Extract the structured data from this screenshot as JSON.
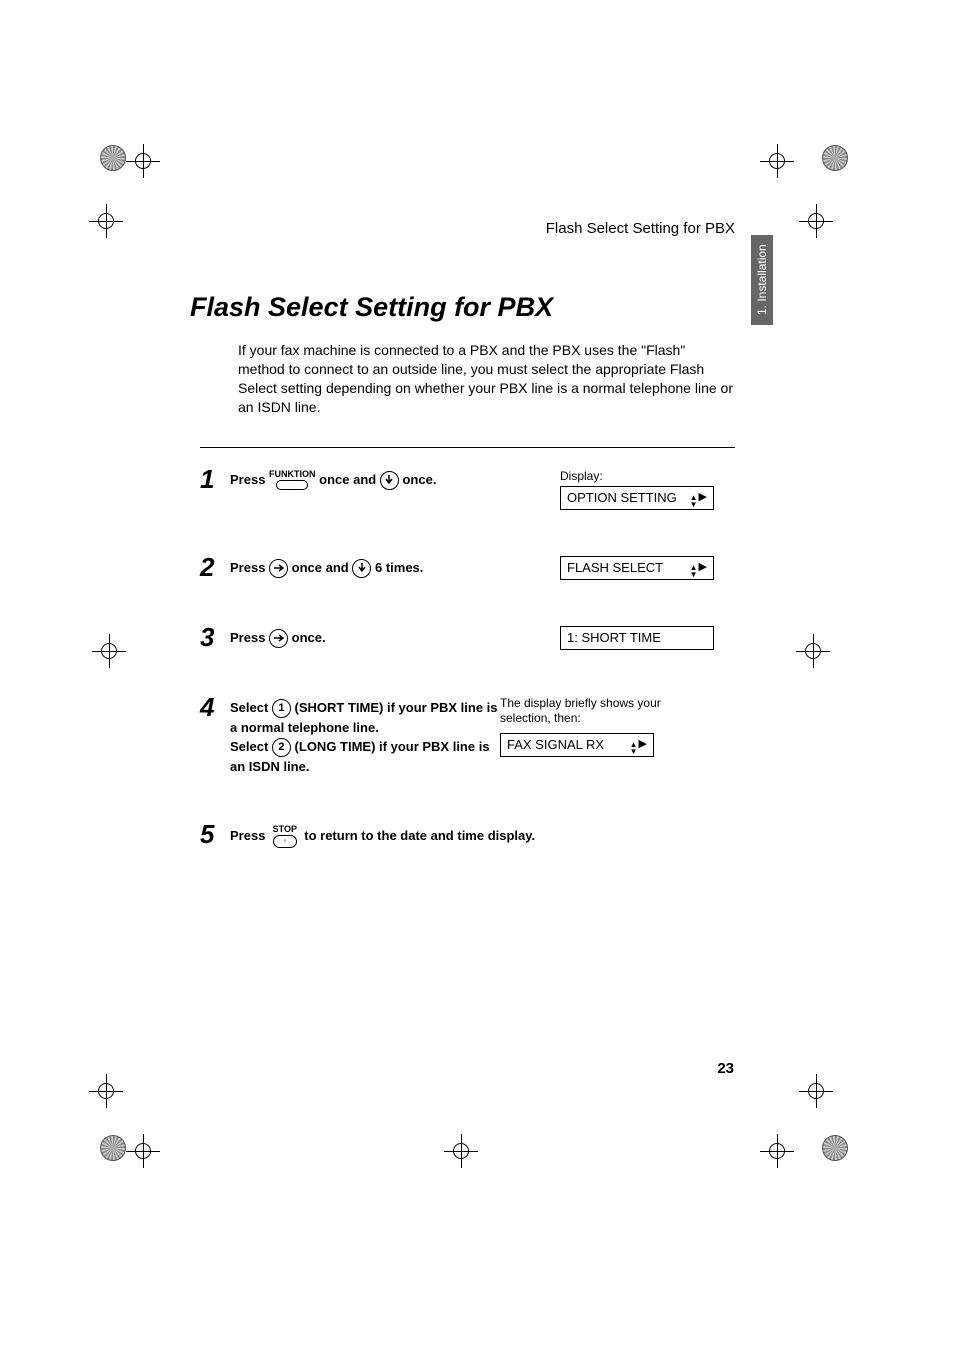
{
  "header": {
    "running_title": "Flash Select Setting for PBX",
    "side_tab": "1. Installation"
  },
  "title": "Flash Select Setting for PBX",
  "intro": "If your fax machine is connected to a PBX and the PBX uses the \"Flash\" method to connect to an outside line, you must select the appropriate Flash Select setting depending on whether your PBX line is a normal telephone line or an ISDN line.",
  "display_label": "Display:",
  "steps": {
    "s1": {
      "num": "1",
      "a": "Press ",
      "key1": "FUNKTION",
      "b": " once and ",
      "c": " once.",
      "display": "OPTION SETTING"
    },
    "s2": {
      "num": "2",
      "a": "Press ",
      "b": " once and ",
      "c": " 6 times.",
      "display": "FLASH SELECT"
    },
    "s3": {
      "num": "3",
      "a": "Press ",
      "b": " once.",
      "display": "1: SHORT TIME"
    },
    "s4": {
      "num": "4",
      "a": "Select ",
      "key1": "1",
      "b": " (SHORT TIME) if your PBX line is a normal telephone line.",
      "c": "Select ",
      "key2": "2",
      "d": " (LONG TIME) if your PBX line is an ISDN line.",
      "note": "The display briefly shows your selection, then:",
      "display": "FAX SIGNAL RX"
    },
    "s5": {
      "num": "5",
      "a": "Press ",
      "key1": "STOP",
      "b": " to return to the date and time display."
    }
  },
  "page_number": "23"
}
